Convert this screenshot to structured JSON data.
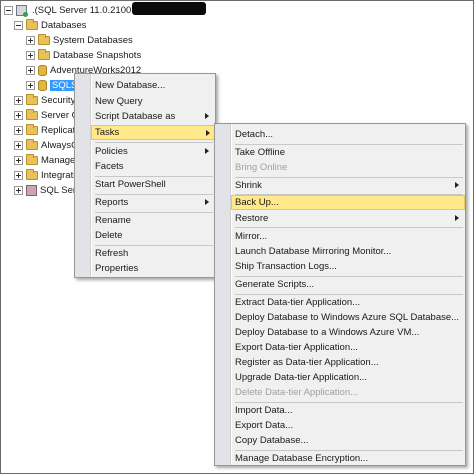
{
  "tree": {
    "server": "(SQL Server 11.0.2100",
    "databases": "Databases",
    "system_databases": "System Databases",
    "database_snapshots": "Database Snapshots",
    "adventureworks": "AdventureWorks2012",
    "selected_db": "SQLSha",
    "security": "Security",
    "server_objects": "Server Ob",
    "replication": "Replicatio",
    "alwayson": "AlwaysOn",
    "management": "Managem",
    "integration": "Integratio",
    "sql_server_agent": "SQL Serve"
  },
  "context_menu": {
    "new_database": "New Database...",
    "new_query": "New Query",
    "script_database_as": "Script Database as",
    "tasks": "Tasks",
    "policies": "Policies",
    "facets": "Facets",
    "start_powershell": "Start PowerShell",
    "reports": "Reports",
    "rename": "Rename",
    "delete": "Delete",
    "refresh": "Refresh",
    "properties": "Properties"
  },
  "tasks_menu": {
    "detach": "Detach...",
    "take_offline": "Take Offline",
    "bring_online": "Bring Online",
    "shrink": "Shrink",
    "back_up": "Back Up...",
    "restore": "Restore",
    "mirror": "Mirror...",
    "launch_mirroring_monitor": "Launch Database Mirroring Monitor...",
    "ship_transaction_logs": "Ship Transaction Logs...",
    "generate_scripts": "Generate Scripts...",
    "extract_data_tier": "Extract Data-tier Application...",
    "deploy_azure_sql": "Deploy Database to Windows Azure SQL Database...",
    "deploy_azure_vm": "Deploy Database to a Windows Azure VM...",
    "export_data_tier": "Export Data-tier Application...",
    "register_data_tier": "Register as Data-tier Application...",
    "upgrade_data_tier": "Upgrade Data-tier Application...",
    "delete_data_tier": "Delete Data-tier Application...",
    "import_data": "Import Data...",
    "export_data": "Export Data...",
    "copy_database": "Copy Database...",
    "manage_encryption": "Manage Database Encryption..."
  },
  "colors": {
    "highlight": "#ffe98a",
    "selection": "#3399ff",
    "menu_background": "#f0f0f0",
    "disabled_text": "#a0a0a0"
  }
}
